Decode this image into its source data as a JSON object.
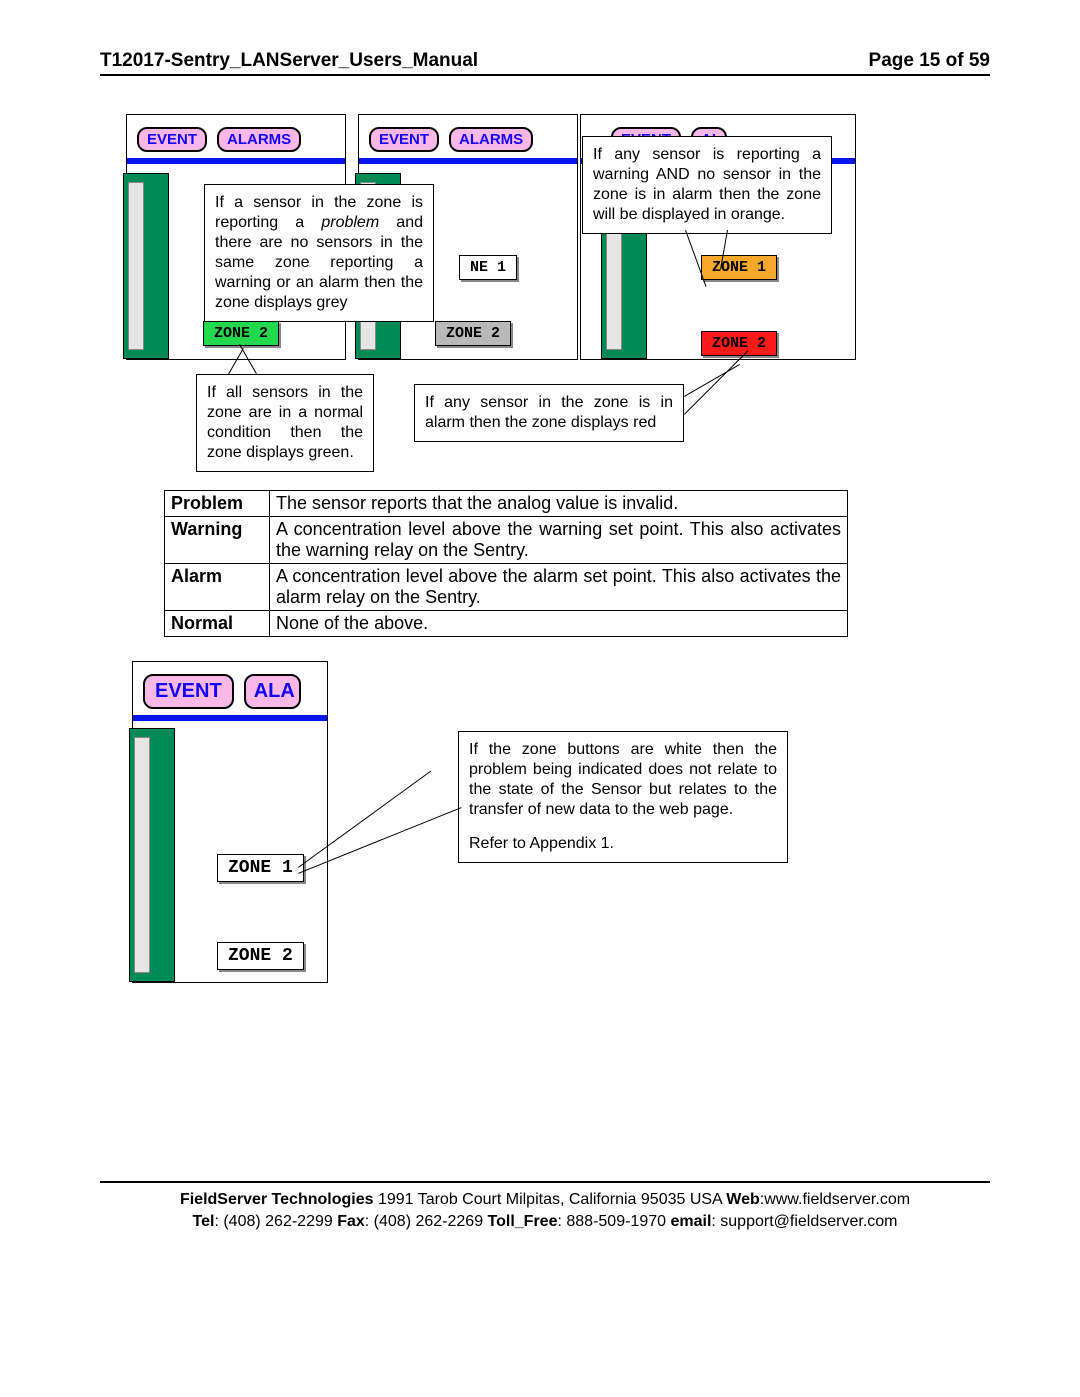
{
  "header": {
    "title": "T12017-Sentry_LANServer_Users_Manual",
    "page": "Page 15 of 59"
  },
  "panels": {
    "tabs": {
      "event": "EVENT",
      "alarms": "ALARMS",
      "alarm_short": "AL",
      "alarm_shorter": "ALA"
    }
  },
  "zones": {
    "z1_green_label": "ZONE 2",
    "z1_partial": "NE 1",
    "z2_grey": "ZONE 2",
    "z1_orange": "ZONE 1",
    "z2_red": "ZONE 2",
    "z1_white": "ZONE 1",
    "z2_white": "ZONE 2"
  },
  "callouts": {
    "grey": {
      "pre": "If a sensor in the zone is reporting a ",
      "em": "problem",
      "post": " and there are no sensors in the same zone reporting a warning or an alarm then the zone displays grey"
    },
    "orange": "If any sensor is reporting a warning AND no sensor in the zone is in alarm then the zone will be displayed in orange.",
    "green": "If all sensors in the zone are in a normal condition then the zone displays green.",
    "red": "If any sensor in the zone is in alarm then the zone displays red",
    "white": {
      "p1": "If the zone buttons are white then the problem being indicated does not relate to the state of the Sensor but relates to the transfer of new data to the web page.",
      "p2": "Refer to Appendix 1."
    }
  },
  "defs": {
    "problem": {
      "k": "Problem",
      "v": "The sensor reports that the analog value is invalid."
    },
    "warning": {
      "k": "Warning",
      "v": "A concentration level above the warning set point. This also activates the warning relay on the Sentry."
    },
    "alarm": {
      "k": "Alarm",
      "v": "A concentration level above the alarm set point. This also activates the alarm relay on the Sentry."
    },
    "normal": {
      "k": "Normal",
      "v": "None of the above."
    }
  },
  "footer": {
    "line1": {
      "company": "FieldServer Technologies",
      "addr": " 1991 Tarob Court Milpitas, California 95035 USA ",
      "web_k": "Web",
      "web_v": ":www.fieldserver.com"
    },
    "line2": {
      "tel_k": "Tel",
      "tel_v": ": (408) 262-2299  ",
      "fax_k": "Fax",
      "fax_v": ": (408) 262-2269  ",
      "tfree_k": "Toll_Free",
      "tfree_v": ": 888-509-1970  ",
      "email_k": "email",
      "email_v": ": support@fieldserver.com"
    }
  }
}
